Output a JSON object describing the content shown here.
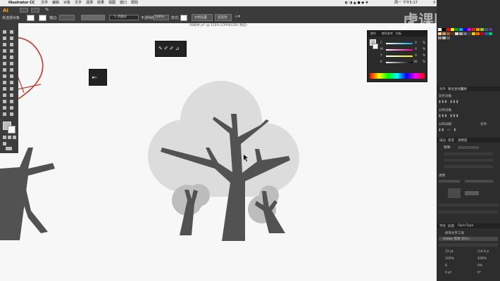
{
  "menubar": {
    "app": "Illustrator CC",
    "items": [
      "文件",
      "编辑",
      "对象",
      "文字",
      "选择",
      "效果",
      "视图",
      "窗口",
      "帮助"
    ],
    "clock": "周一 下午5:17"
  },
  "watermark": "虎课网",
  "control_bar": {
    "selection_label": "未选择对象",
    "stroke_label": "描边:",
    "stroke_value": "5 点圆形",
    "opacity_label": "不透明度:",
    "opacity_value": "100%",
    "style_label": "样式:",
    "doc_setup": "文档设置",
    "preferences": "首选项"
  },
  "document": {
    "title": "08树木.ai* @ 150% (CMYK/GPU 预览)"
  },
  "color_panel": {
    "tabs": [
      "颜色",
      "颜色参考",
      "色板"
    ],
    "sliders": [
      {
        "label": "C",
        "value": "0"
      },
      {
        "label": "M",
        "value": "0"
      },
      {
        "label": "Y",
        "value": "0"
      },
      {
        "label": "K",
        "value": "30"
      }
    ],
    "unit": "%"
  },
  "align_panel": {
    "tabs": [
      "对齐",
      "路径查找器",
      "变换"
    ],
    "align_objects": "对齐对象:",
    "distribute_objects": "分布对象:",
    "distribute_spacing": "分布间距:",
    "align_to": "对齐:"
  },
  "stroke_panel": {
    "tabs": [
      "描边",
      "渐变",
      "透明度"
    ],
    "weight_label": "粗细:"
  },
  "transparency_panel": {
    "title": "透明"
  },
  "char_panel": {
    "tabs": [
      "字符",
      "段落",
      "OpenType"
    ],
    "touch_type": "修饰文字工具",
    "font": "Adobe 黑体 Std L",
    "size": "12 pt",
    "leading": "(14.4 p",
    "scale_v": "100%",
    "scale_h": "100%",
    "kerning": "0",
    "tracking": "0%",
    "baseline": "0 pt",
    "rotate": "0°"
  },
  "colors": {
    "tree": "#525252",
    "canopy": "#dcdcdc",
    "bush": "#bdbdbd",
    "sketch": "#c0392b"
  }
}
